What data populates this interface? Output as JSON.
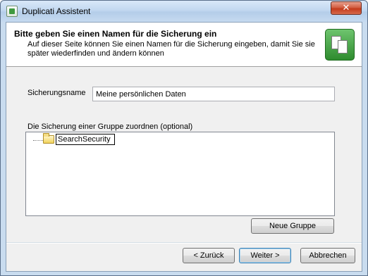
{
  "window": {
    "title": "Duplicati Assistent",
    "close_label": "✕"
  },
  "header": {
    "title": "Bitte geben Sie einen Namen für die Sicherung ein",
    "description": "Auf dieser Seite können Sie einen Namen für die Sicherung eingeben, damit Sie sie später wiederfinden und ändern können",
    "icon": "backup-documents-icon"
  },
  "form": {
    "name_label": "Sicherungsname",
    "name_value": "Meine persönlichen Daten",
    "group_label": "Die Sicherung einer Gruppe zuordnen (optional)",
    "group_tree": {
      "items": [
        {
          "label": "SearchSecurity",
          "icon": "folder-icon",
          "editing": true
        }
      ]
    },
    "new_group_label": "Neue Gruppe"
  },
  "footer": {
    "back_label": "< Zurück",
    "next_label": "Weiter >",
    "cancel_label": "Abbrechen"
  }
}
